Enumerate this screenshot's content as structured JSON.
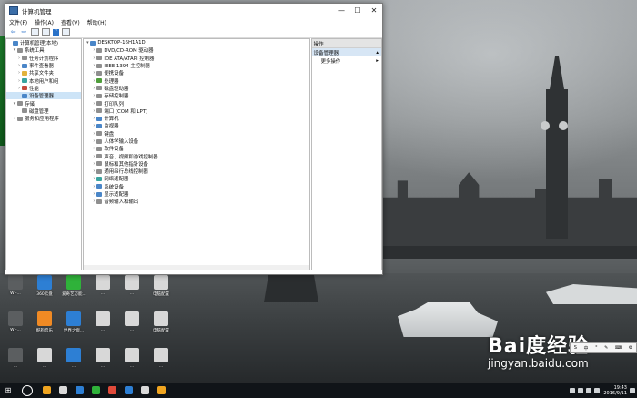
{
  "window": {
    "title": "计算机管理",
    "menu": [
      "文件(F)",
      "操作(A)",
      "查看(V)",
      "帮助(H)"
    ],
    "controls": {
      "minimize": "—",
      "maximize": "☐",
      "close": "✕"
    }
  },
  "left_tree": [
    {
      "label": "计算机管理(本地)",
      "level": 0,
      "expander": "",
      "icon": "computer-management-icon",
      "color": "blue"
    },
    {
      "label": "系统工具",
      "level": 1,
      "expander": "▾",
      "icon": "system-tools-icon",
      "color": "gray"
    },
    {
      "label": "任务计划程序",
      "level": 2,
      "expander": "›",
      "icon": "task-scheduler-icon",
      "color": "gray"
    },
    {
      "label": "事件查看器",
      "level": 2,
      "expander": "›",
      "icon": "event-viewer-icon",
      "color": "blue"
    },
    {
      "label": "共享文件夹",
      "level": 2,
      "expander": "›",
      "icon": "shared-folder-icon",
      "color": "yellow"
    },
    {
      "label": "本地用户和组",
      "level": 2,
      "expander": "›",
      "icon": "local-users-icon",
      "color": "teal"
    },
    {
      "label": "性能",
      "level": 2,
      "expander": "›",
      "icon": "performance-icon",
      "color": "red"
    },
    {
      "label": "设备管理器",
      "level": 2,
      "expander": "",
      "icon": "device-manager-icon",
      "color": "blue",
      "selected": true
    },
    {
      "label": "存储",
      "level": 1,
      "expander": "▾",
      "icon": "storage-icon",
      "color": "gray"
    },
    {
      "label": "磁盘管理",
      "level": 2,
      "expander": "",
      "icon": "disk-management-icon",
      "color": "gray"
    },
    {
      "label": "服务和应用程序",
      "level": 1,
      "expander": "›",
      "icon": "services-icon",
      "color": "gray"
    }
  ],
  "device_tree": {
    "root": "DESKTOP-16H1A1D",
    "items": [
      {
        "label": "DVD/CD-ROM 驱动器",
        "icon": "dvd-drive-icon",
        "color": "gray"
      },
      {
        "label": "IDE ATA/ATAPI 控制器",
        "icon": "ide-controller-icon",
        "color": "gray"
      },
      {
        "label": "IEEE 1394 主控制器",
        "icon": "ieee1394-icon",
        "color": "gray"
      },
      {
        "label": "便携设备",
        "icon": "portable-device-icon",
        "color": "gray"
      },
      {
        "label": "处理器",
        "icon": "processor-icon",
        "color": "green"
      },
      {
        "label": "磁盘驱动器",
        "icon": "disk-drive-icon",
        "color": "gray"
      },
      {
        "label": "存储控制器",
        "icon": "storage-controller-icon",
        "color": "gray"
      },
      {
        "label": "打印队列",
        "icon": "print-queue-icon",
        "color": "gray"
      },
      {
        "label": "端口 (COM 和 LPT)",
        "icon": "port-icon",
        "color": "gray"
      },
      {
        "label": "计算机",
        "icon": "computer-icon",
        "color": "blue"
      },
      {
        "label": "监视器",
        "icon": "monitor-icon",
        "color": "blue"
      },
      {
        "label": "键盘",
        "icon": "keyboard-icon",
        "color": "gray"
      },
      {
        "label": "人体学输入设备",
        "icon": "hid-icon",
        "color": "gray"
      },
      {
        "label": "软件设备",
        "icon": "software-device-icon",
        "color": "gray"
      },
      {
        "label": "声音、视频和游戏控制器",
        "icon": "sound-icon",
        "color": "gray"
      },
      {
        "label": "鼠标和其他指针设备",
        "icon": "mouse-icon",
        "color": "gray"
      },
      {
        "label": "通用串行总线控制器",
        "icon": "usb-icon",
        "color": "gray"
      },
      {
        "label": "网络适配器",
        "icon": "network-adapter-icon",
        "color": "teal"
      },
      {
        "label": "系统设备",
        "icon": "system-device-icon",
        "color": "blue"
      },
      {
        "label": "显示适配器",
        "icon": "display-adapter-icon",
        "color": "blue"
      },
      {
        "label": "音频输入和输出",
        "icon": "audio-io-icon",
        "color": "gray"
      }
    ]
  },
  "actions": {
    "header": "操作",
    "section": "设备管理器",
    "more": "更多操作"
  },
  "desktop_icons": [
    {
      "label": "WI-...",
      "color": "#5b5e60"
    },
    {
      "label": "360云盘",
      "color": "#2d7fd4"
    },
    {
      "label": "爱奇艺万能...",
      "color": "#2fb23a"
    },
    {
      "label": "...",
      "color": "#d8d8d8"
    },
    {
      "label": "...",
      "color": "#d8d8d8"
    },
    {
      "label": "电脑配置",
      "color": "#d8d8d8"
    },
    {
      "label": "WI-...",
      "color": "#5b5e60"
    },
    {
      "label": "酷狗音乐",
      "color": "#f08a24"
    },
    {
      "label": "世界之窗...",
      "color": "#2d7fd4"
    },
    {
      "label": "...",
      "color": "#d8d8d8"
    },
    {
      "label": "...",
      "color": "#d8d8d8"
    },
    {
      "label": "电脑配置",
      "color": "#d8d8d8"
    },
    {
      "label": "...",
      "color": "#5b5e60"
    },
    {
      "label": "...",
      "color": "#d8d8d8"
    },
    {
      "label": "...",
      "color": "#2d7fd4"
    },
    {
      "label": "...",
      "color": "#d8d8d8"
    },
    {
      "label": "...",
      "color": "#d8d8d8"
    },
    {
      "label": "...",
      "color": "#d8d8d8"
    }
  ],
  "watermark": {
    "brand": "Bai度经验",
    "site": "jingyan.baidu.com"
  },
  "taskbar": {
    "time": "19:43",
    "date": "2016/9/11",
    "apps": [
      "#f0a520",
      "#d9d9d9",
      "#2d7fd4",
      "#2fb23a",
      "#e04a3a",
      "#2d7fd4",
      "#d9d9d9",
      "#f0a520"
    ]
  }
}
